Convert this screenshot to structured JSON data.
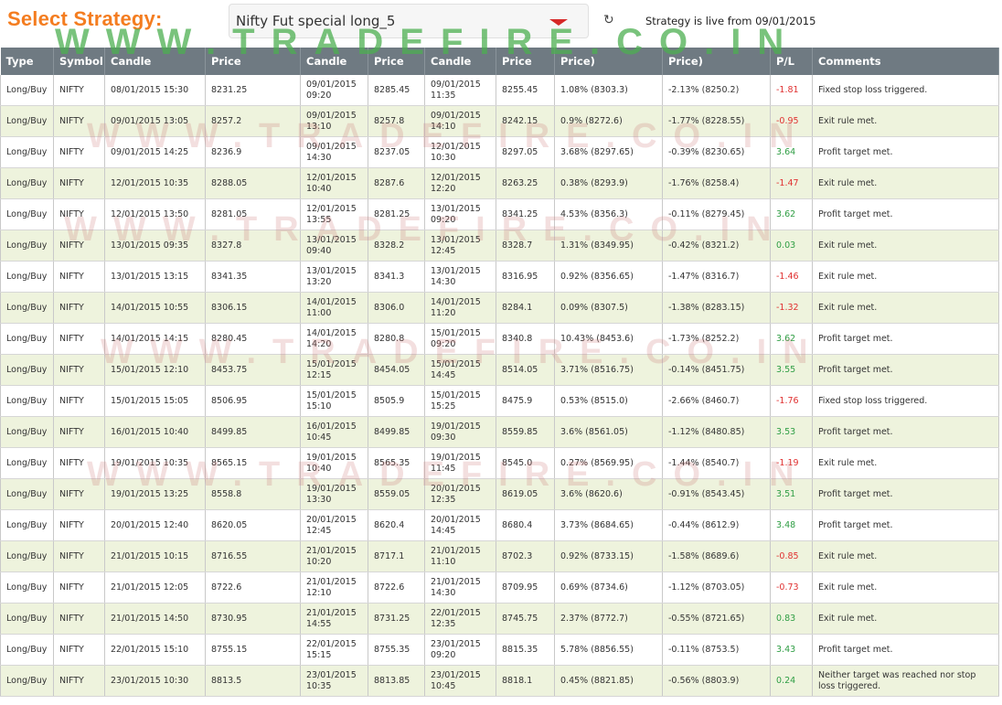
{
  "header": {
    "title": "Select Strategy:",
    "selected_strategy": "Nifty Fut special long_5",
    "refresh_icon": "↻",
    "live_text": "Strategy is live from 09/01/2015",
    "watermark": "WWW.TRADEFIRE.CO.IN"
  },
  "table": {
    "columns": [
      {
        "top": "Type",
        "bottom": ""
      },
      {
        "top": "Symbol",
        "bottom": ""
      },
      {
        "top": "",
        "bottom": "Candle"
      },
      {
        "top": "",
        "bottom": "Price"
      },
      {
        "top": "",
        "bottom": "Candle"
      },
      {
        "top": "",
        "bottom": "Price"
      },
      {
        "top": "",
        "bottom": "Candle"
      },
      {
        "top": "",
        "bottom": "Price"
      },
      {
        "top": "",
        "bottom": "Price)"
      },
      {
        "top": "",
        "bottom": "Price)"
      },
      {
        "top": "P/L",
        "bottom": ""
      },
      {
        "top": "Comments",
        "bottom": ""
      }
    ],
    "rows": [
      {
        "type": "Long/Buy",
        "symbol": "NIFTY",
        "signal_candle": "08/01/2015 15:30",
        "signal_price": "8231.25",
        "entry_date": "09/01/2015",
        "entry_time": "09:20",
        "entry_price": "8285.45",
        "exit_date": "09/01/2015",
        "exit_time": "11:35",
        "exit_price": "8255.45",
        "max_gain": "1.08% (8303.3)",
        "max_loss": "-2.13% (8250.2)",
        "pl": "-1.81",
        "comment": "Fixed stop loss triggered."
      },
      {
        "type": "Long/Buy",
        "symbol": "NIFTY",
        "signal_candle": "09/01/2015 13:05",
        "signal_price": "8257.2",
        "entry_date": "09/01/2015",
        "entry_time": "13:10",
        "entry_price": "8257.8",
        "exit_date": "09/01/2015",
        "exit_time": "14:10",
        "exit_price": "8242.15",
        "max_gain": "0.9% (8272.6)",
        "max_loss": "-1.77% (8228.55)",
        "pl": "-0.95",
        "comment": "Exit rule met."
      },
      {
        "type": "Long/Buy",
        "symbol": "NIFTY",
        "signal_candle": "09/01/2015 14:25",
        "signal_price": "8236.9",
        "entry_date": "09/01/2015",
        "entry_time": "14:30",
        "entry_price": "8237.05",
        "exit_date": "12/01/2015",
        "exit_time": "10:30",
        "exit_price": "8297.05",
        "max_gain": "3.68% (8297.65)",
        "max_loss": "-0.39% (8230.65)",
        "pl": "3.64",
        "comment": "Profit target met."
      },
      {
        "type": "Long/Buy",
        "symbol": "NIFTY",
        "signal_candle": "12/01/2015 10:35",
        "signal_price": "8288.05",
        "entry_date": "12/01/2015",
        "entry_time": "10:40",
        "entry_price": "8287.6",
        "exit_date": "12/01/2015",
        "exit_time": "12:20",
        "exit_price": "8263.25",
        "max_gain": "0.38% (8293.9)",
        "max_loss": "-1.76% (8258.4)",
        "pl": "-1.47",
        "comment": "Exit rule met."
      },
      {
        "type": "Long/Buy",
        "symbol": "NIFTY",
        "signal_candle": "12/01/2015 13:50",
        "signal_price": "8281.05",
        "entry_date": "12/01/2015",
        "entry_time": "13:55",
        "entry_price": "8281.25",
        "exit_date": "13/01/2015",
        "exit_time": "09:20",
        "exit_price": "8341.25",
        "max_gain": "4.53% (8356.3)",
        "max_loss": "-0.11% (8279.45)",
        "pl": "3.62",
        "comment": "Profit target met."
      },
      {
        "type": "Long/Buy",
        "symbol": "NIFTY",
        "signal_candle": "13/01/2015 09:35",
        "signal_price": "8327.8",
        "entry_date": "13/01/2015",
        "entry_time": "09:40",
        "entry_price": "8328.2",
        "exit_date": "13/01/2015",
        "exit_time": "12:45",
        "exit_price": "8328.7",
        "max_gain": "1.31% (8349.95)",
        "max_loss": "-0.42% (8321.2)",
        "pl": "0.03",
        "comment": "Exit rule met."
      },
      {
        "type": "Long/Buy",
        "symbol": "NIFTY",
        "signal_candle": "13/01/2015 13:15",
        "signal_price": "8341.35",
        "entry_date": "13/01/2015",
        "entry_time": "13:20",
        "entry_price": "8341.3",
        "exit_date": "13/01/2015",
        "exit_time": "14:30",
        "exit_price": "8316.95",
        "max_gain": "0.92% (8356.65)",
        "max_loss": "-1.47% (8316.7)",
        "pl": "-1.46",
        "comment": "Exit rule met."
      },
      {
        "type": "Long/Buy",
        "symbol": "NIFTY",
        "signal_candle": "14/01/2015 10:55",
        "signal_price": "8306.15",
        "entry_date": "14/01/2015",
        "entry_time": "11:00",
        "entry_price": "8306.0",
        "exit_date": "14/01/2015",
        "exit_time": "11:20",
        "exit_price": "8284.1",
        "max_gain": "0.09% (8307.5)",
        "max_loss": "-1.38% (8283.15)",
        "pl": "-1.32",
        "comment": "Exit rule met."
      },
      {
        "type": "Long/Buy",
        "symbol": "NIFTY",
        "signal_candle": "14/01/2015 14:15",
        "signal_price": "8280.45",
        "entry_date": "14/01/2015",
        "entry_time": "14:20",
        "entry_price": "8280.8",
        "exit_date": "15/01/2015",
        "exit_time": "09:20",
        "exit_price": "8340.8",
        "max_gain": "10.43% (8453.6)",
        "max_loss": "-1.73% (8252.2)",
        "pl": "3.62",
        "comment": "Profit target met."
      },
      {
        "type": "Long/Buy",
        "symbol": "NIFTY",
        "signal_candle": "15/01/2015 12:10",
        "signal_price": "8453.75",
        "entry_date": "15/01/2015",
        "entry_time": "12:15",
        "entry_price": "8454.05",
        "exit_date": "15/01/2015",
        "exit_time": "14:45",
        "exit_price": "8514.05",
        "max_gain": "3.71% (8516.75)",
        "max_loss": "-0.14% (8451.75)",
        "pl": "3.55",
        "comment": "Profit target met."
      },
      {
        "type": "Long/Buy",
        "symbol": "NIFTY",
        "signal_candle": "15/01/2015 15:05",
        "signal_price": "8506.95",
        "entry_date": "15/01/2015",
        "entry_time": "15:10",
        "entry_price": "8505.9",
        "exit_date": "15/01/2015",
        "exit_time": "15:25",
        "exit_price": "8475.9",
        "max_gain": "0.53% (8515.0)",
        "max_loss": "-2.66% (8460.7)",
        "pl": "-1.76",
        "comment": "Fixed stop loss triggered."
      },
      {
        "type": "Long/Buy",
        "symbol": "NIFTY",
        "signal_candle": "16/01/2015 10:40",
        "signal_price": "8499.85",
        "entry_date": "16/01/2015",
        "entry_time": "10:45",
        "entry_price": "8499.85",
        "exit_date": "19/01/2015",
        "exit_time": "09:30",
        "exit_price": "8559.85",
        "max_gain": "3.6% (8561.05)",
        "max_loss": "-1.12% (8480.85)",
        "pl": "3.53",
        "comment": "Profit target met."
      },
      {
        "type": "Long/Buy",
        "symbol": "NIFTY",
        "signal_candle": "19/01/2015 10:35",
        "signal_price": "8565.15",
        "entry_date": "19/01/2015",
        "entry_time": "10:40",
        "entry_price": "8565.35",
        "exit_date": "19/01/2015",
        "exit_time": "11:45",
        "exit_price": "8545.0",
        "max_gain": "0.27% (8569.95)",
        "max_loss": "-1.44% (8540.7)",
        "pl": "-1.19",
        "comment": "Exit rule met."
      },
      {
        "type": "Long/Buy",
        "symbol": "NIFTY",
        "signal_candle": "19/01/2015 13:25",
        "signal_price": "8558.8",
        "entry_date": "19/01/2015",
        "entry_time": "13:30",
        "entry_price": "8559.05",
        "exit_date": "20/01/2015",
        "exit_time": "12:35",
        "exit_price": "8619.05",
        "max_gain": "3.6% (8620.6)",
        "max_loss": "-0.91% (8543.45)",
        "pl": "3.51",
        "comment": "Profit target met."
      },
      {
        "type": "Long/Buy",
        "symbol": "NIFTY",
        "signal_candle": "20/01/2015 12:40",
        "signal_price": "8620.05",
        "entry_date": "20/01/2015",
        "entry_time": "12:45",
        "entry_price": "8620.4",
        "exit_date": "20/01/2015",
        "exit_time": "14:45",
        "exit_price": "8680.4",
        "max_gain": "3.73% (8684.65)",
        "max_loss": "-0.44% (8612.9)",
        "pl": "3.48",
        "comment": "Profit target met."
      },
      {
        "type": "Long/Buy",
        "symbol": "NIFTY",
        "signal_candle": "21/01/2015 10:15",
        "signal_price": "8716.55",
        "entry_date": "21/01/2015",
        "entry_time": "10:20",
        "entry_price": "8717.1",
        "exit_date": "21/01/2015",
        "exit_time": "11:10",
        "exit_price": "8702.3",
        "max_gain": "0.92% (8733.15)",
        "max_loss": "-1.58% (8689.6)",
        "pl": "-0.85",
        "comment": "Exit rule met."
      },
      {
        "type": "Long/Buy",
        "symbol": "NIFTY",
        "signal_candle": "21/01/2015 12:05",
        "signal_price": "8722.6",
        "entry_date": "21/01/2015",
        "entry_time": "12:10",
        "entry_price": "8722.6",
        "exit_date": "21/01/2015",
        "exit_time": "14:30",
        "exit_price": "8709.95",
        "max_gain": "0.69% (8734.6)",
        "max_loss": "-1.12% (8703.05)",
        "pl": "-0.73",
        "comment": "Exit rule met."
      },
      {
        "type": "Long/Buy",
        "symbol": "NIFTY",
        "signal_candle": "21/01/2015 14:50",
        "signal_price": "8730.95",
        "entry_date": "21/01/2015",
        "entry_time": "14:55",
        "entry_price": "8731.25",
        "exit_date": "22/01/2015",
        "exit_time": "12:35",
        "exit_price": "8745.75",
        "max_gain": "2.37% (8772.7)",
        "max_loss": "-0.55% (8721.65)",
        "pl": "0.83",
        "comment": "Exit rule met."
      },
      {
        "type": "Long/Buy",
        "symbol": "NIFTY",
        "signal_candle": "22/01/2015 15:10",
        "signal_price": "8755.15",
        "entry_date": "22/01/2015",
        "entry_time": "15:15",
        "entry_price": "8755.35",
        "exit_date": "23/01/2015",
        "exit_time": "09:20",
        "exit_price": "8815.35",
        "max_gain": "5.78% (8856.55)",
        "max_loss": "-0.11% (8753.5)",
        "pl": "3.43",
        "comment": "Profit target met."
      },
      {
        "type": "Long/Buy",
        "symbol": "NIFTY",
        "signal_candle": "23/01/2015 10:30",
        "signal_price": "8813.5",
        "entry_date": "23/01/2015",
        "entry_time": "10:35",
        "entry_price": "8813.85",
        "exit_date": "23/01/2015",
        "exit_time": "10:45",
        "exit_price": "8818.1",
        "max_gain": "0.45% (8821.85)",
        "max_loss": "-0.56% (8803.9)",
        "pl": "0.24",
        "comment": "Neither target was reached nor stop loss triggered."
      }
    ]
  }
}
